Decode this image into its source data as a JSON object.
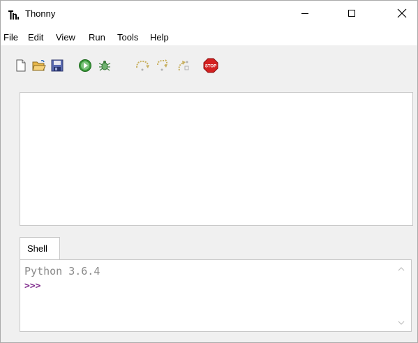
{
  "window": {
    "title": "Thonny",
    "icon": "thonny-logo-icon",
    "controls": [
      "minimize-icon",
      "maximize-icon",
      "close-icon"
    ]
  },
  "menubar": {
    "items": [
      "File",
      "Edit",
      "View",
      "Run",
      "Tools",
      "Help"
    ]
  },
  "toolbar": {
    "buttons": [
      {
        "name": "new-file-icon"
      },
      {
        "name": "open-folder-icon"
      },
      {
        "name": "save-icon"
      },
      {
        "name": "run-icon"
      },
      {
        "name": "debug-icon"
      },
      {
        "name": "step-over-icon"
      },
      {
        "name": "step-into-icon"
      },
      {
        "name": "step-out-icon"
      },
      {
        "name": "stop-icon",
        "label": "STOP"
      }
    ]
  },
  "shell": {
    "tab_label": "Shell",
    "output": "Python 3.6.4",
    "prompt": ">>>"
  },
  "colors": {
    "prompt": "#7f2a8c",
    "output": "#8a8a8a",
    "run_green": "#3a9a3a",
    "stop_red": "#d42020"
  }
}
